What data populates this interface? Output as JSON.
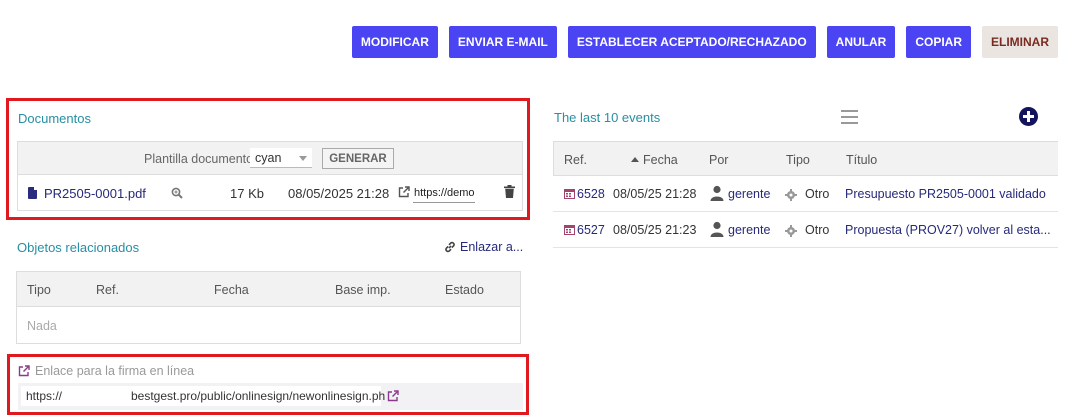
{
  "toolbar": {
    "modify": "MODIFICAR",
    "send_email": "ENVIAR E-MAIL",
    "set_status": "ESTABLECER ACEPTADO/RECHAZADO",
    "cancel": "ANULAR",
    "copy": "COPIAR",
    "delete": "ELIMINAR"
  },
  "documents": {
    "title": "Documentos",
    "template_label": "Plantilla documento",
    "template_value": "cyan",
    "generate_label": "GENERAR",
    "file": {
      "name": "PR2505-0001.pdf",
      "size": "17 Kb",
      "date": "08/05/2025 21:28",
      "link": "https://demo-i"
    }
  },
  "related": {
    "title": "Objetos relacionados",
    "link_label": "Enlazar a...",
    "columns": [
      "Tipo",
      "Ref.",
      "Fecha",
      "Base imp.",
      "Estado"
    ],
    "empty": "Nada"
  },
  "online_sign": {
    "label": "Enlace para la firma en línea",
    "url_prefix": "https://",
    "url_suffix": "bestgest.pro/public/onlinesign/newonlinesign.ph"
  },
  "events": {
    "title": "The last 10 events",
    "columns": [
      "Ref.",
      "Fecha",
      "Por",
      "Tipo",
      "Título"
    ],
    "rows": [
      {
        "ref": "6528",
        "date": "08/05/25 21:28",
        "by": "gerente",
        "type": "Otro",
        "title": "Presupuesto PR2505-0001 validado"
      },
      {
        "ref": "6527",
        "date": "08/05/25 21:23",
        "by": "gerente",
        "type": "Otro",
        "title": "Propuesta (PROV27) volver al esta..."
      }
    ]
  },
  "colors": {
    "primary_button": "#4a44f2",
    "delete_button": "#eae5e1",
    "link": "#262a7a",
    "section_title": "#268fa4",
    "highlight": "#e0191f"
  }
}
